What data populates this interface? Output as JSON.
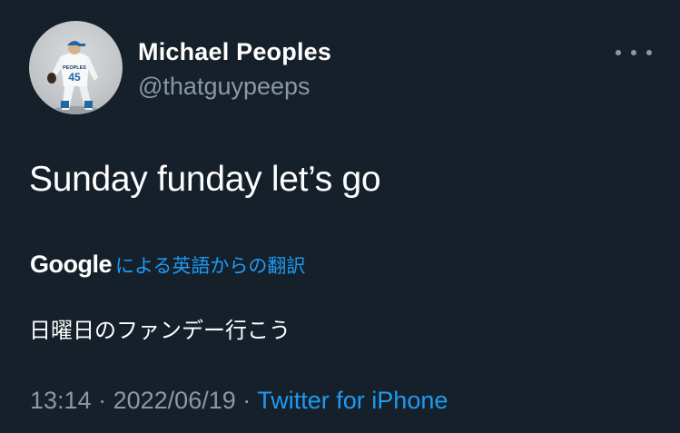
{
  "tweet": {
    "author_name": "Michael Peoples",
    "author_handle": "@thatguypeeps",
    "text": "Sunday funday let’s go",
    "translation": {
      "provider": "Google",
      "label": "による英語からの翻訳",
      "text": "日曜日のファンデー行こう"
    },
    "time": "13:14",
    "separator": "·",
    "date": "2022/06/19",
    "source": "Twitter for iPhone"
  },
  "avatar": {
    "jersey_name": "PEOPLES",
    "jersey_number": "45"
  },
  "colors": {
    "background": "#15202b",
    "secondary_text": "#8b98a5",
    "link": "#1d9bf0"
  },
  "icons": {
    "more": "more-horizontal-icon"
  }
}
